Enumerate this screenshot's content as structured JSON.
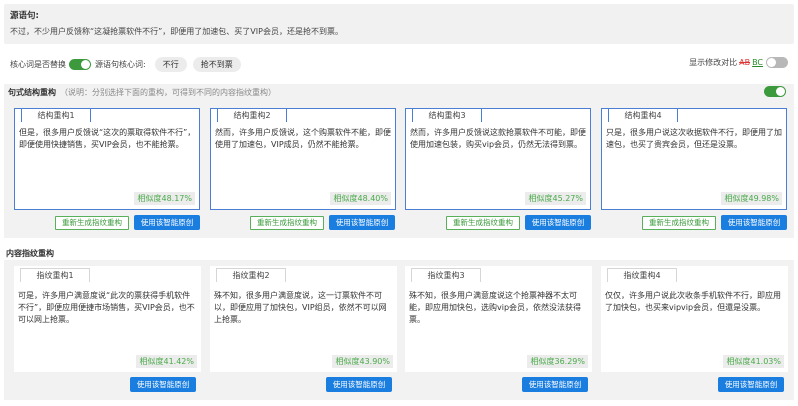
{
  "source": {
    "title": "源语句:",
    "text": "不过，不少用户反馈称“这凝抢票软件不行”，即便用了加速包、买了VIP会员，还是抢不到票。"
  },
  "keywords": {
    "replace_label": "核心词是否替换",
    "source_label": "源语句核心词:",
    "words": [
      "不行",
      "抢不到票"
    ],
    "diff_label": "显示修改对比",
    "diff_ab": "AB",
    "diff_bc": "BC"
  },
  "structure": {
    "title": "句式结构重构",
    "hint": "（说明：分别选择下面的重构，可得到不同的内容指纹重构）",
    "regen_label": "重新生成指纹重构",
    "use_label": "使用该智能原创",
    "cards": [
      {
        "tab": "结构重构1",
        "text": "但是，很多用户反馈说“这次的票取得软件不行”，即便使用快捷销售，买VIP会员，也不能抢票。",
        "sim": "相似度48.17%"
      },
      {
        "tab": "结构重构2",
        "text": "然而，许多用户反馈说，这个购票软件不能，即便使用了加速包，VIP成员，仍然不能抢票。",
        "sim": "相似度48.40%"
      },
      {
        "tab": "结构重构3",
        "text": "然而，许多用户反馈说这款抢票软件不可能，即便使用加速包装，购买vip会员，仍然无法得到票。",
        "sim": "相似度45.27%"
      },
      {
        "tab": "结构重构4",
        "text": "只是，很多用户说这次收据软件不行，即便用了加速包，也买了贵宾会员，但还是没票。",
        "sim": "相似度49.98%"
      }
    ]
  },
  "content": {
    "title": "内容指纹重构",
    "use_label": "使用该智能原创",
    "cards": [
      {
        "tab": "指纹重构1",
        "text": "可是，许多用户满意度说“此次的票获得手机软件不行”，即便应用便捷市场销售，买VIP会员，也不可以网上抢票。",
        "sim": "相似度41.42%"
      },
      {
        "tab": "指纹重构2",
        "text": "殊不知，很多用户满意度说，这一订票软件不可以，即便应用了加快包，VIP组员，依然不可以网上抢票。",
        "sim": "相似度43.90%"
      },
      {
        "tab": "指纹重构3",
        "text": "殊不知，很多用户满意度说这个抢票神器不太可能，即应用加快包，选购vip会员，依然没法获得票。",
        "sim": "相似度36.29%"
      },
      {
        "tab": "指纹重构4",
        "text": "仅仅，许多用户说此次收条手机软件不行，即应用了加快包，也买来vipvip会员，但還是没票。",
        "sim": "相似度41.03%"
      }
    ]
  }
}
